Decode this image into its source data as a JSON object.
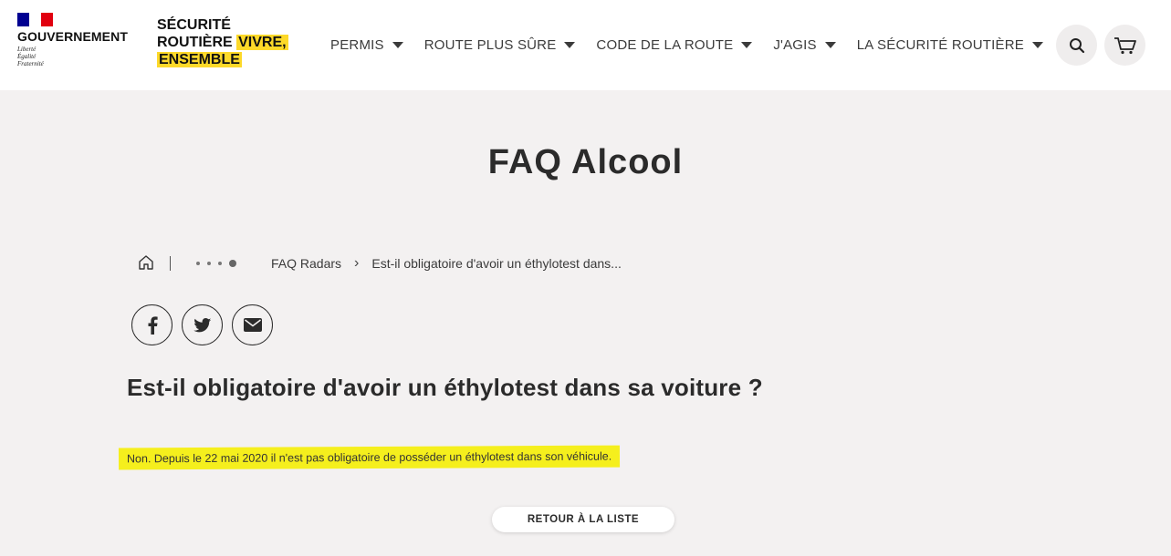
{
  "header": {
    "gov": {
      "name": "GOUVERNEMENT",
      "motto": [
        "Liberté",
        "Égalité",
        "Fraternité"
      ],
      "flag_colors": [
        "#000091",
        "#ffffff",
        "#e1000f"
      ]
    },
    "brand": {
      "line1": "SÉCURITÉ",
      "line2": "ROUTIÈRE",
      "highlight1": "VIVRE,",
      "highlight2": "ENSEMBLE",
      "highlight_color": "#fdd929"
    },
    "nav": [
      {
        "label": "PERMIS"
      },
      {
        "label": "ROUTE PLUS SÛRE"
      },
      {
        "label": "CODE DE LA ROUTE"
      },
      {
        "label": "J'AGIS"
      },
      {
        "label": "LA SÉCURITÉ ROUTIÈRE"
      }
    ],
    "icons": {
      "search": "search-icon",
      "cart": "cart-icon"
    }
  },
  "page": {
    "title": "FAQ Alcool"
  },
  "breadcrumb": {
    "home_icon": "home-icon",
    "items": [
      "FAQ Radars",
      "Est-il obligatoire d'avoir un éthylotest dans..."
    ]
  },
  "share": {
    "icons": [
      "facebook-icon",
      "twitter-icon",
      "mail-icon"
    ]
  },
  "content": {
    "question": "Est-il obligatoire d'avoir un éthylotest dans sa voiture ?",
    "answer": "Non. Depuis le 22 mai 2020 il n'est pas obligatoire de posséder un éthylotest dans son véhicule.",
    "answer_highlight_color": "#f5ef1d"
  },
  "actions": {
    "back_label": "RETOUR À LA LISTE"
  }
}
